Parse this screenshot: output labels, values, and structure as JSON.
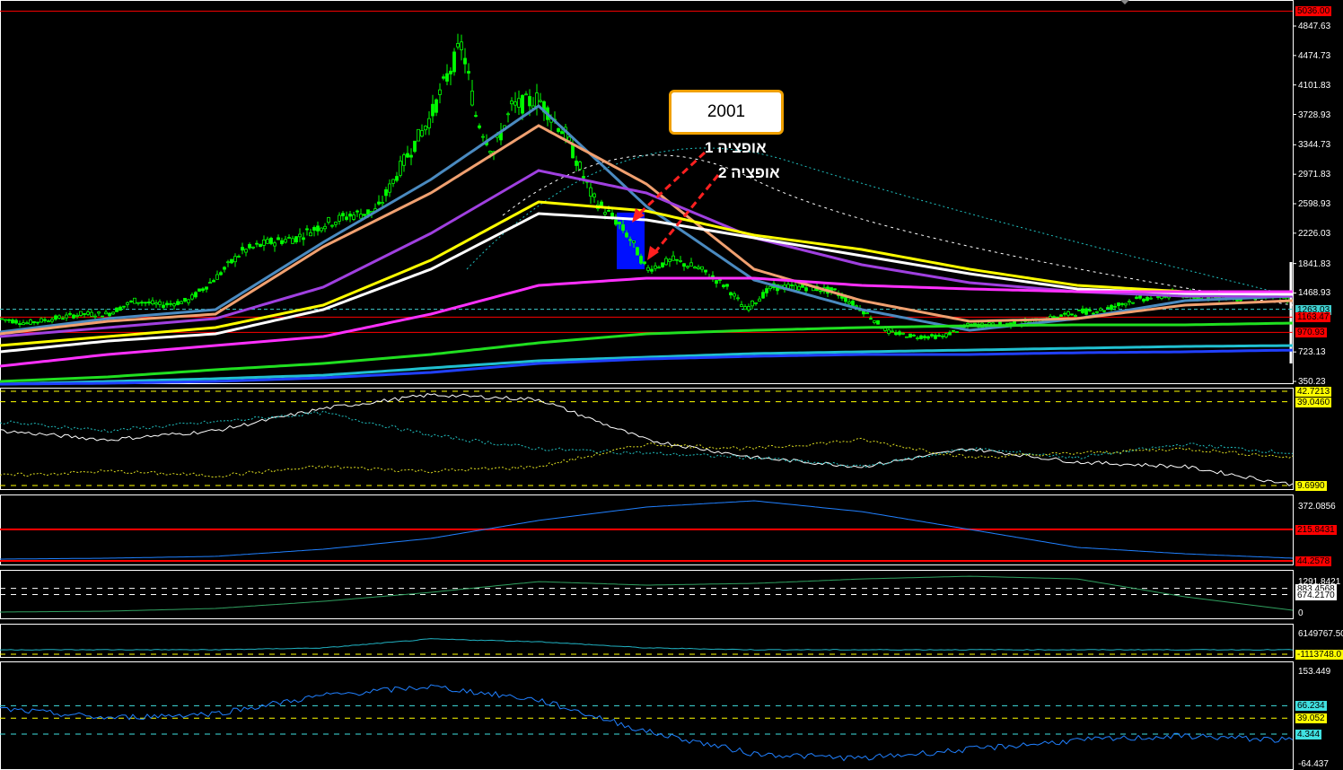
{
  "chart_data": {
    "type": "line",
    "title": "",
    "x_index": [
      0,
      1,
      2,
      3,
      4,
      5,
      6,
      7,
      8,
      9,
      10,
      11,
      12
    ],
    "main": {
      "ylim": [
        350.23,
        5036.0
      ],
      "ticks": [
        "4847.63",
        "4474.73",
        "4101.83",
        "3728.93",
        "3344.73",
        "2971.83",
        "2598.93",
        "2226.03",
        "1841.83",
        "1468.93",
        "723.13",
        "350.23"
      ],
      "tick_values": [
        4847.63,
        4474.73,
        4101.83,
        3728.93,
        3344.73,
        2971.83,
        2598.93,
        2226.03,
        1841.83,
        1468.93,
        723.13,
        350.23
      ],
      "price_x": [
        0,
        0.25,
        0.5,
        0.75,
        1,
        1.25,
        1.5,
        1.75,
        2,
        2.25,
        2.5,
        2.75,
        3,
        3.25,
        3.5,
        3.75,
        4,
        4.17,
        4.29,
        4.42,
        4.58,
        4.75,
        5,
        5.25,
        5.5,
        5.75,
        5.87,
        6,
        6.25,
        6.5,
        6.75,
        6.92,
        7.17,
        7.5,
        7.75,
        8,
        8.25,
        8.5,
        8.75,
        9,
        9.25,
        9.5,
        9.75,
        10,
        10.25,
        10.5,
        10.75,
        11,
        11.25,
        11.5,
        11.75,
        12
      ],
      "price": [
        1145,
        1088,
        1145,
        1202,
        1202,
        1372,
        1316,
        1372,
        1656,
        1997,
        2110,
        2167,
        2338,
        2451,
        2508,
        3133,
        3700,
        4268,
        4609,
        3700,
        3246,
        3814,
        3927,
        3473,
        2678,
        2338,
        2110,
        1770,
        1884,
        1770,
        1543,
        1259,
        1543,
        1543,
        1486,
        1259,
        975,
        918,
        918,
        1066,
        1066,
        1088,
        1145,
        1225,
        1259,
        1372,
        1429,
        1452,
        1429,
        1406,
        1429,
        1372
      ],
      "series": [
        {
          "name": "ma-steelblue",
          "color": "#4a8ac0",
          "values": [
            975,
            1145,
            1259,
            2110,
            2906,
            3837,
            2565,
            1634,
            1259,
            997,
            1145,
            1372,
            1429
          ]
        },
        {
          "name": "ma-orange",
          "color": "#f0a070",
          "values": [
            952,
            1111,
            1202,
            2054,
            2735,
            3587,
            2849,
            1770,
            1372,
            1111,
            1145,
            1316,
            1372
          ]
        },
        {
          "name": "ma-purple",
          "color": "#a040e0",
          "values": [
            918,
            1032,
            1145,
            1543,
            2224,
            3019,
            2735,
            2167,
            1827,
            1600,
            1486,
            1429,
            1429
          ]
        },
        {
          "name": "ma-yellow",
          "color": "#ffff00",
          "values": [
            804,
            918,
            1032,
            1316,
            1884,
            2622,
            2508,
            2201,
            2020,
            1770,
            1565,
            1486,
            1486
          ]
        },
        {
          "name": "ma-white",
          "color": "#ffffff",
          "values": [
            725,
            861,
            952,
            1259,
            1770,
            2474,
            2394,
            2167,
            1940,
            1713,
            1520,
            1463,
            1452
          ]
        },
        {
          "name": "ma-magenta",
          "color": "#ff30ff",
          "values": [
            543,
            691,
            804,
            918,
            1202,
            1565,
            1656,
            1656,
            1565,
            1520,
            1486,
            1486,
            1486
          ]
        },
        {
          "name": "ma-green",
          "color": "#20e020",
          "values": [
            350,
            407,
            498,
            577,
            691,
            838,
            952,
            997,
            1032,
            1054,
            1066,
            1066,
            1088
          ]
        },
        {
          "name": "ma-cyan",
          "color": "#20c0d0",
          "values": [
            316,
            350,
            384,
            429,
            520,
            611,
            657,
            702,
            725,
            747,
            770,
            793,
            804
          ]
        },
        {
          "name": "ma-blue",
          "color": "#2040ff",
          "values": [
            316,
            327,
            350,
            396,
            464,
            577,
            634,
            668,
            691,
            691,
            713,
            725,
            747
          ]
        }
      ],
      "levels": [
        {
          "value": 5036.0,
          "label": "5036.00",
          "color": "#ff0000",
          "style": "solid"
        },
        {
          "value": 1263.03,
          "label": "1263.03",
          "color": "#40d0d0",
          "style": "dashed"
        },
        {
          "value": 1163.47,
          "label": "1163.47",
          "color": "#ff0000",
          "style": "solid"
        },
        {
          "value": 970.93,
          "label": "970.93",
          "color": "#ff0000",
          "style": "solid"
        }
      ],
      "highlight_range": [
        1770,
        2487
      ],
      "annotation_box": "2001",
      "option1": "אופציה 1",
      "option2": "אופציה 2"
    },
    "panel2": {
      "ylim": [
        9.699,
        42.7213
      ],
      "series": [
        {
          "name": "white",
          "color": "#ffffff",
          "dash": false,
          "values": [
            28.9,
            25.7,
            28.9,
            36.7,
            41.5,
            39.9,
            25.7,
            19.5,
            16.3,
            22.6,
            17.9,
            16.3,
            10.0
          ]
        },
        {
          "name": "cyan",
          "color": "#20c0c0",
          "dash": true,
          "values": [
            32.0,
            28.9,
            32.0,
            35.2,
            27.3,
            22.6,
            21.0,
            19.5,
            16.3,
            22.6,
            19.5,
            24.2,
            21.0
          ]
        },
        {
          "name": "yellow",
          "color": "#e0e020",
          "dash": true,
          "values": [
            13.1,
            14.7,
            13.1,
            16.3,
            14.7,
            16.3,
            24.2,
            22.6,
            25.7,
            19.5,
            21.0,
            22.6,
            19.5
          ]
        }
      ],
      "levels": [
        {
          "value": 42.7213,
          "label": "42.7213",
          "color": "#ffff00"
        },
        {
          "value": 39.046,
          "label": "39.0460",
          "color": "#ffff00"
        },
        {
          "value": 9.699,
          "label": "9.6990",
          "color": "#ffff00"
        }
      ]
    },
    "panel3": {
      "ylim": [
        44.2578,
        372.0856
      ],
      "max_label": "372.0856",
      "series": [
        {
          "name": "blue",
          "color": "#2080ff",
          "dash": false,
          "values": [
            54,
            59,
            69,
            108,
            167,
            265,
            338,
            372,
            313,
            216,
            118,
            83,
            59
          ]
        }
      ],
      "levels": [
        {
          "value": 215.8431,
          "label": "215.8431",
          "color": "#ff0000"
        },
        {
          "value": 44.2578,
          "label": "44.2578",
          "color": "#ff0000"
        }
      ]
    },
    "panel4": {
      "ylim": [
        0,
        1291.8421
      ],
      "max_label": "1291.8421",
      "min_label": "0",
      "series": [
        {
          "name": "green",
          "color": "#30a060",
          "dash": false,
          "values": [
            90,
            120,
            210,
            450,
            750,
            1110,
            990,
            1050,
            1200,
            1290,
            1200,
            600,
            150
          ]
        }
      ],
      "levels": [
        {
          "value": 883.4568,
          "label": "883.4568",
          "color": "#ffffff"
        },
        {
          "value": 674.217,
          "label": "674.2170",
          "color": "#ffffff"
        }
      ]
    },
    "panel5": {
      "ylim": [
        -1113748.0,
        6149767.5
      ],
      "max_label": "6149767.50",
      "series": [
        {
          "name": "cyan",
          "color": "#20b0c0",
          "dash": false,
          "values": [
            138600,
            138600,
            138600,
            639500,
            3144000,
            2392000,
            639500,
            138600,
            138600,
            138600,
            138600,
            138600,
            138600
          ]
        }
      ],
      "levels": [
        {
          "value": -1113748.0,
          "label": "-1113748.0",
          "color": "#ffff00"
        }
      ]
    },
    "panel6": {
      "ylim": [
        -64.437,
        153.449
      ],
      "max_label": "153.449",
      "min_label": "-64.437",
      "series": [
        {
          "name": "blue",
          "color": "#2080ff",
          "dash": false,
          "values": [
            59.2,
            39.6,
            49.4,
            88.7,
            108.3,
            78.9,
            10.1,
            -38.9,
            -48.8,
            -29.1,
            -9.5,
            0.3,
            -9.5
          ]
        }
      ],
      "levels": [
        {
          "value": 66.234,
          "label": "66.234",
          "color": "#40e0e0"
        },
        {
          "value": 39.052,
          "label": "39.052",
          "color": "#ffff00"
        },
        {
          "value": 4.344,
          "label": "4.344",
          "color": "#40e0e0"
        }
      ]
    }
  }
}
